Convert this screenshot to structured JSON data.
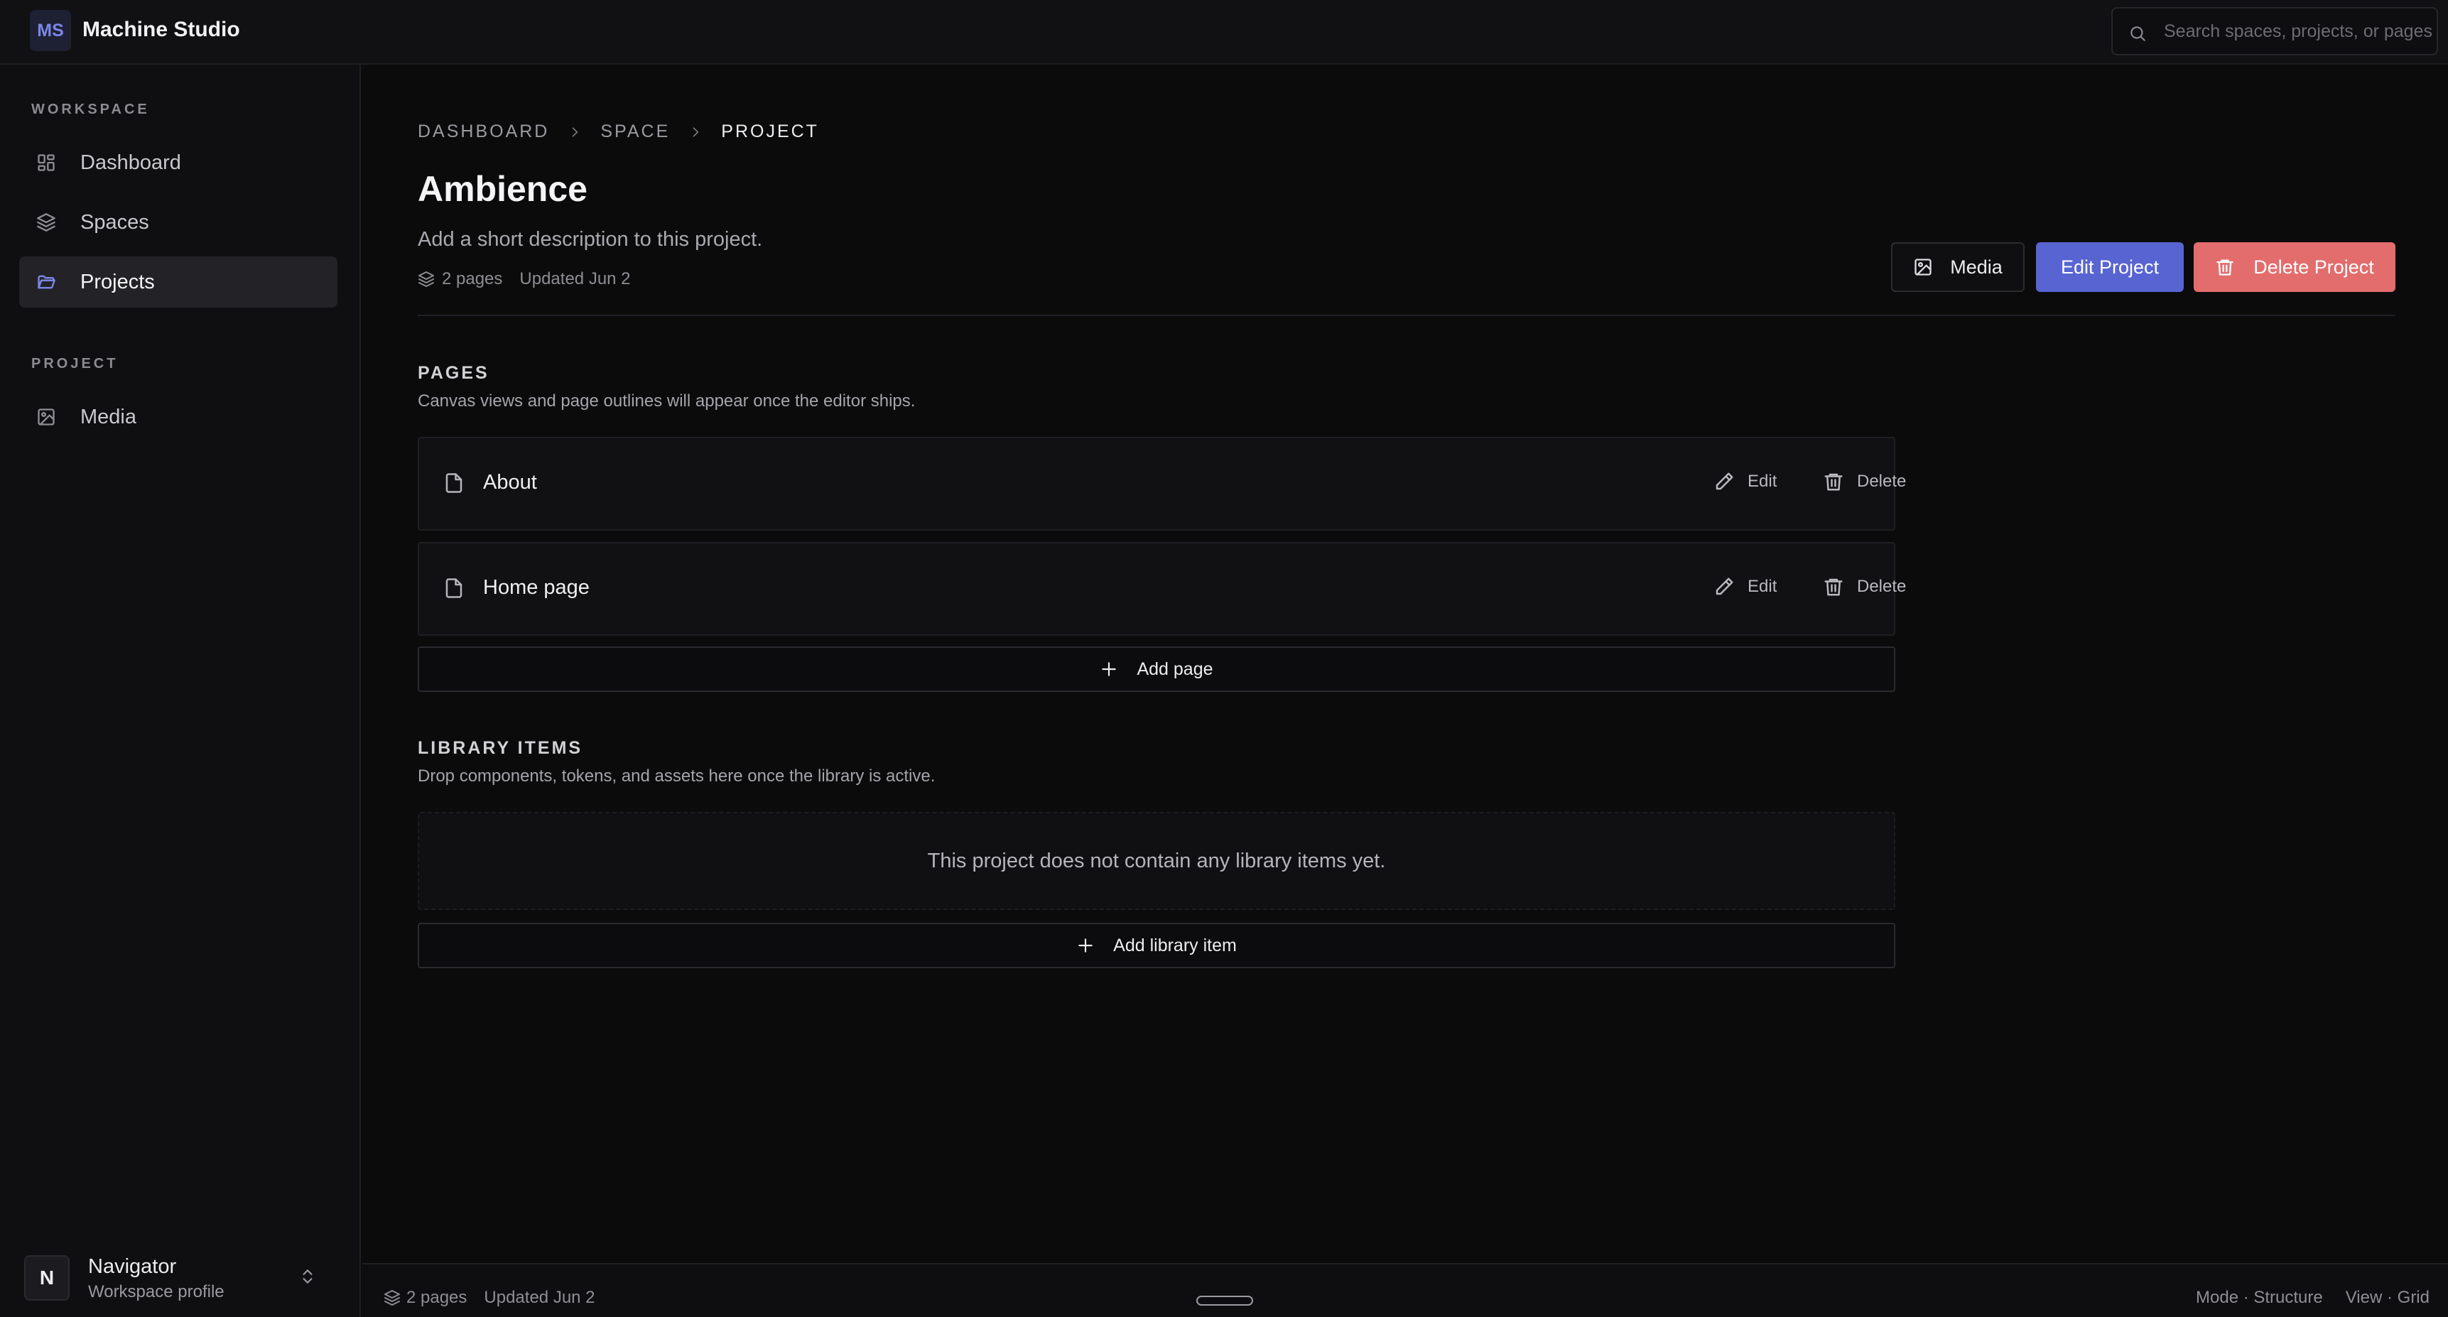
{
  "app": {
    "logo": "MS",
    "title": "Machine Studio"
  },
  "search": {
    "placeholder": "Search spaces, projects, or pages",
    "value": ""
  },
  "sidebar": {
    "workspace_label": "WORKSPACE",
    "workspace_items": [
      {
        "label": "Dashboard",
        "icon": "dashboard-icon"
      },
      {
        "label": "Spaces",
        "icon": "layers-icon"
      },
      {
        "label": "Projects",
        "icon": "folder-icon",
        "active": true
      }
    ],
    "project_label": "PROJECT",
    "project_items": [
      {
        "label": "Media",
        "icon": "image-icon"
      }
    ],
    "profile": {
      "initial": "N",
      "name": "Navigator",
      "subtitle": "Workspace profile"
    }
  },
  "breadcrumb": [
    "DASHBOARD",
    "SPACE",
    "PROJECT"
  ],
  "project": {
    "title": "Ambience",
    "description": "Add a short description to this project.",
    "pages_count": "2 pages",
    "updated": "Updated Jun 2"
  },
  "actions": {
    "media": "Media",
    "edit": "Edit Project",
    "delete": "Delete Project"
  },
  "pages_section": {
    "title": "PAGES",
    "subtitle": "Canvas views and page outlines will appear once the editor ships.",
    "items": [
      {
        "name": "About",
        "edit": "Edit",
        "delete": "Delete"
      },
      {
        "name": "Home page",
        "edit": "Edit",
        "delete": "Delete"
      }
    ],
    "add_label": "Add page"
  },
  "library_section": {
    "title": "LIBRARY ITEMS",
    "subtitle": "Drop components, tokens, and assets here once the library is active.",
    "empty": "This project does not contain any library items yet.",
    "add_label": "Add library item"
  },
  "statusbar": {
    "pages_count": "2 pages",
    "updated": "Updated Jun 2",
    "mode": "Mode · Structure",
    "view": "View · Grid"
  },
  "colors": {
    "accent": "#5864d2",
    "danger": "#e36d6d",
    "background": "#0b0b0c"
  }
}
